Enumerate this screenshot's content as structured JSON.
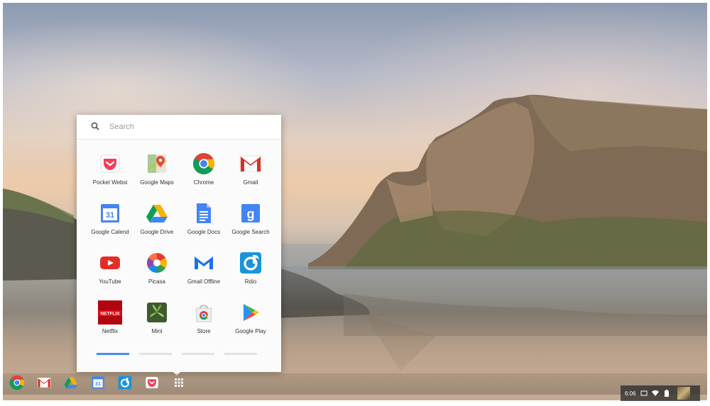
{
  "launcher": {
    "search_placeholder": "Search",
    "apps": [
      {
        "label": "Pocket Websi",
        "icon": "pocket-icon"
      },
      {
        "label": "Google Maps",
        "icon": "maps-icon"
      },
      {
        "label": "Chrome",
        "icon": "chrome-icon"
      },
      {
        "label": "Gmail",
        "icon": "gmail-icon"
      },
      {
        "label": "Google Calend",
        "icon": "calendar-icon"
      },
      {
        "label": "Google Drive",
        "icon": "drive-icon"
      },
      {
        "label": "Google Docs",
        "icon": "docs-icon"
      },
      {
        "label": "Google Search",
        "icon": "google-search-icon"
      },
      {
        "label": "YouTube",
        "icon": "youtube-icon"
      },
      {
        "label": "Picasa",
        "icon": "picasa-icon"
      },
      {
        "label": "Gmail Offline",
        "icon": "gmail-offline-icon"
      },
      {
        "label": "Rdio",
        "icon": "rdio-icon"
      },
      {
        "label": "Netflix",
        "icon": "netflix-icon"
      },
      {
        "label": "Mint",
        "icon": "mint-icon"
      },
      {
        "label": "Store",
        "icon": "store-icon"
      },
      {
        "label": "Google Play",
        "icon": "google-play-icon"
      }
    ],
    "pages": 4,
    "active_page": 1,
    "icon_text": {
      "calendar": "31",
      "google": "g",
      "netflix": "NETFLIX"
    }
  },
  "shelf": {
    "items": [
      "chrome-icon",
      "gmail-icon",
      "drive-icon",
      "calendar-icon",
      "rdio-icon",
      "pocket-icon",
      "app-launcher-icon"
    ],
    "calendar_text": "31"
  },
  "tray": {
    "time": "6:06"
  },
  "colors": {
    "accent": "#4a8af4",
    "red": "#e53935",
    "green": "#2e9e4f",
    "yellow": "#f6b400"
  }
}
